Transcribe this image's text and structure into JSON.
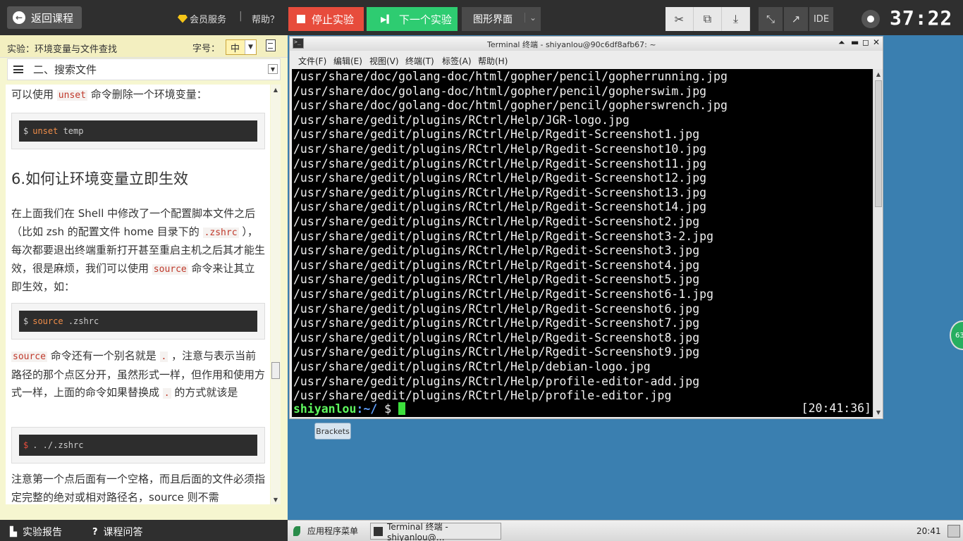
{
  "topbar": {
    "back_label": "返回课程",
    "vip_label": "会员服务",
    "separator": "|",
    "help_label": "帮助？",
    "stop_label": "停止实验",
    "next_label": "下一个实验",
    "gui_label": "图形界面",
    "ide_label": "IDE",
    "timer": "37:22"
  },
  "doc": {
    "title": "实验：环境变量与文件查找",
    "font_size_label": "字号：",
    "font_size_value": "中",
    "section": "二、搜索文件",
    "p1_pre": "可以使用",
    "p1_code": "unset",
    "p1_post": "命令删除一个环境变量：",
    "code1_cmd": "unset",
    "code1_arg": " temp",
    "heading": "6.如何让环境变量立即生效",
    "p2_a": "在上面我们在 Shell 中修改了一个配置脚本文件之后（比如 zsh 的配置文件 home 目录下的",
    "p2_code1": ".zshrc",
    "p2_b": "），每次都要退出终端重新打开甚至重启主机之后其才能生效，很是麻烦，我们可以使用",
    "p2_code2": "source",
    "p2_c": "命令来让其立即生效，如：",
    "code2_cmd": "source",
    "code2_arg": " .zshrc",
    "p3_code1": "source",
    "p3_a": "命令还有一个别名就是",
    "p3_code2": ".",
    "p3_b": "，注意与表示当前路径的那个点区分开，虽然形式一样，但作用和使用方式一样，上面的命令如果替换成",
    "p3_code3": ".",
    "p3_c": "的方式就该是",
    "code3_text": ". ./.zshrc",
    "p4": "注意第一个点后面有一个空格，而且后面的文件必须指定完整的绝对或相对路径名，source 则不需",
    "dollar": "$",
    "footer_report": "实验报告",
    "footer_qa": "课程问答"
  },
  "terminal": {
    "title": "Terminal 终端 - shiyanlou@90c6df8afb67: ~",
    "menu": [
      "文件(F)",
      "编辑(E)",
      "视图(V)",
      "终端(T)",
      "标签(A)",
      "帮助(H)"
    ],
    "lines": [
      "/usr/share/doc/golang-doc/html/gopher/pencil/gopherrunning.jpg",
      "/usr/share/doc/golang-doc/html/gopher/pencil/gopherswim.jpg",
      "/usr/share/doc/golang-doc/html/gopher/pencil/gopherswrench.jpg",
      "/usr/share/gedit/plugins/RCtrl/Help/JGR-logo.jpg",
      "/usr/share/gedit/plugins/RCtrl/Help/Rgedit-Screenshot1.jpg",
      "/usr/share/gedit/plugins/RCtrl/Help/Rgedit-Screenshot10.jpg",
      "/usr/share/gedit/plugins/RCtrl/Help/Rgedit-Screenshot11.jpg",
      "/usr/share/gedit/plugins/RCtrl/Help/Rgedit-Screenshot12.jpg",
      "/usr/share/gedit/plugins/RCtrl/Help/Rgedit-Screenshot13.jpg",
      "/usr/share/gedit/plugins/RCtrl/Help/Rgedit-Screenshot14.jpg",
      "/usr/share/gedit/plugins/RCtrl/Help/Rgedit-Screenshot2.jpg",
      "/usr/share/gedit/plugins/RCtrl/Help/Rgedit-Screenshot3-2.jpg",
      "/usr/share/gedit/plugins/RCtrl/Help/Rgedit-Screenshot3.jpg",
      "/usr/share/gedit/plugins/RCtrl/Help/Rgedit-Screenshot4.jpg",
      "/usr/share/gedit/plugins/RCtrl/Help/Rgedit-Screenshot5.jpg",
      "/usr/share/gedit/plugins/RCtrl/Help/Rgedit-Screenshot6-1.jpg",
      "/usr/share/gedit/plugins/RCtrl/Help/Rgedit-Screenshot6.jpg",
      "/usr/share/gedit/plugins/RCtrl/Help/Rgedit-Screenshot7.jpg",
      "/usr/share/gedit/plugins/RCtrl/Help/Rgedit-Screenshot8.jpg",
      "/usr/share/gedit/plugins/RCtrl/Help/Rgedit-Screenshot9.jpg",
      "/usr/share/gedit/plugins/RCtrl/Help/debian-logo.jpg",
      "/usr/share/gedit/plugins/RCtrl/Help/profile-editor-add.jpg",
      "/usr/share/gedit/plugins/RCtrl/Help/profile-editor.jpg"
    ],
    "prompt_user": "shiyanlou",
    "prompt_path": ":~/",
    "prompt_sign": " $ ",
    "clock": "[20:41:36]"
  },
  "desktop": {
    "brackets_label": "Brackets",
    "badge_text": "63"
  },
  "taskbar": {
    "apps_menu": "应用程序菜单",
    "task_label": "Terminal 终端 - shiyanlou@…",
    "clock": "20:41"
  }
}
